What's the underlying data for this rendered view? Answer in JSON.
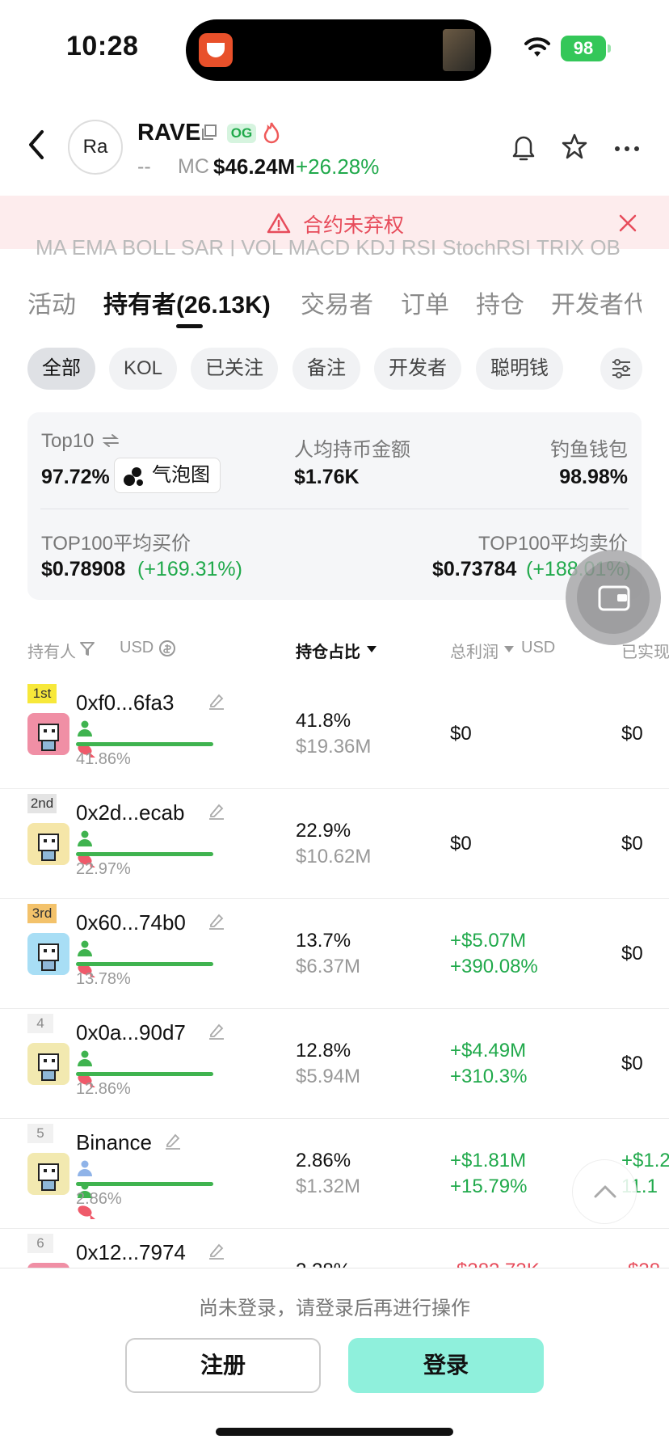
{
  "status_bar": {
    "time": "10:28",
    "battery": "98"
  },
  "header": {
    "token_avatar": "Ra",
    "token_name": "RAVE",
    "badge": "OG",
    "dashes": "--",
    "mc_label": "MC",
    "mc_value": "$46.24M",
    "mc_change": "+26.28%"
  },
  "alert": {
    "text": "合约未弃权"
  },
  "indicators": "MA  EMA  BOLL  SAR  |  VOL  MACD  KDJ  RSI  StochRSI  TRIX  OB",
  "tabs": [
    "活动",
    "持有者(26.13K)",
    "交易者",
    "订单",
    "持仓",
    "开发者代"
  ],
  "filters": [
    "全部",
    "KOL",
    "已关注",
    "备注",
    "开发者",
    "聪明钱"
  ],
  "summary": {
    "top10_label": "Top10",
    "top10_value": "97.72%",
    "bubble_label": "气泡图",
    "avg_amount_label": "人均持币金额",
    "avg_amount_value": "$1.76K",
    "phishing_label": "钓鱼钱包",
    "phishing_value": "98.98%",
    "buy_label": "TOP100平均买价",
    "buy_value": "$0.78908",
    "buy_change": "(+169.31%)",
    "sell_label": "TOP100平均卖价",
    "sell_value": "$0.73784",
    "sell_change": "(+188.01%)"
  },
  "table_header": {
    "holder": "持有人",
    "usd": "USD",
    "share": "持仓占比",
    "profit": "总利润",
    "profit_unit": "USD",
    "realized": "已实现"
  },
  "holders": [
    {
      "rank": "1st",
      "address": "0xf0...6fa3",
      "pct": "41.86%",
      "share": "41.8%",
      "share_usd": "$19.36M",
      "profit": "$0",
      "profit_pct": "",
      "realized": "$0",
      "bar": 1.0,
      "rank_color": "#f7e83a",
      "avatar_color": "#f08fa5"
    },
    {
      "rank": "2nd",
      "address": "0x2d...ecab",
      "pct": "22.97%",
      "share": "22.9%",
      "share_usd": "$10.62M",
      "profit": "$0",
      "profit_pct": "",
      "realized": "$0",
      "bar": 1.0,
      "rank_color": "#e4e4e4",
      "avatar_color": "#f5e6a8"
    },
    {
      "rank": "3rd",
      "address": "0x60...74b0",
      "pct": "13.78%",
      "share": "13.7%",
      "share_usd": "$6.37M",
      "profit": "+$5.07M",
      "profit_pct": "+390.08%",
      "realized": "$0",
      "bar": 1.0,
      "rank_color": "#f3c26b",
      "avatar_color": "#a8def5"
    },
    {
      "rank": "4",
      "address": "0x0a...90d7",
      "pct": "12.86%",
      "share": "12.8%",
      "share_usd": "$5.94M",
      "profit": "+$4.49M",
      "profit_pct": "+310.3%",
      "realized": "$0",
      "bar": 1.0,
      "rank_color": "#f1f1f1",
      "avatar_color": "#f2e9b0"
    },
    {
      "rank": "5",
      "address": "Binance",
      "pct": "2.86%",
      "share": "2.86%",
      "share_usd": "$1.32M",
      "profit": "+$1.81M",
      "profit_pct": "+15.79%",
      "realized": "+$1.2",
      "realized_pct": "11.1",
      "bar": 1.0,
      "rank_color": "#f1f1f1",
      "avatar_color": "#f2e9b0"
    },
    {
      "rank": "6",
      "address": "0x12...7974",
      "pct": "",
      "share": "2.28%",
      "share_usd": "",
      "profit": "-$382.73K",
      "profit_pct": "",
      "realized": "-$38",
      "bar": 1.0,
      "rank_color": "#f1f1f1",
      "avatar_color": "#f08fa5"
    }
  ],
  "bottom": {
    "hint": "尚未登录，请登录后再进行操作",
    "register": "注册",
    "login": "登录"
  },
  "colors": {
    "green": "#20a94b",
    "red": "#e74c5b",
    "login_button": "#8ff0dc",
    "alert_bg": "#fdeced"
  }
}
